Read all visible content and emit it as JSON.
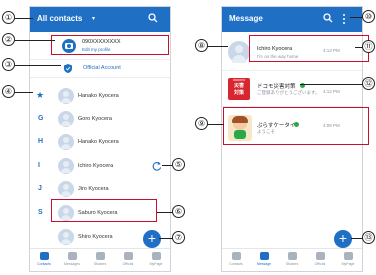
{
  "callouts": [
    "①",
    "②",
    "③",
    "④",
    "⑤",
    "⑥",
    "⑦",
    "⑧",
    "⑨",
    "⑩",
    "⑪",
    "⑫",
    "⑬"
  ],
  "contacts_screen": {
    "title": "All contacts",
    "caret": "▾",
    "profile": {
      "number": "090XXXXXXXX",
      "subtitle": "Edit my profile"
    },
    "official_account": "Official Account",
    "favorite_star": "★",
    "rows": [
      {
        "letter": "",
        "name": "Hanako Kyocera"
      },
      {
        "letter": "G",
        "name": "Goro Kyocera"
      },
      {
        "letter": "H",
        "name": "Hanako Kyocera"
      },
      {
        "letter": "I",
        "name": "Ichiro Kyocera"
      },
      {
        "letter": "J",
        "name": "Jiro Kyocera"
      },
      {
        "letter": "S",
        "name": "Saburo Kyocera"
      },
      {
        "letter": "",
        "name": "Shiro Kyocera"
      }
    ],
    "fab": "+",
    "nav": [
      "Contacts",
      "Messages",
      "Stickers",
      "Official",
      "MyPage"
    ]
  },
  "message_screen": {
    "title": "Message",
    "threads": [
      {
        "name": "Ichiro Kyocera",
        "preview": "I'm on the way home",
        "time": "4:13 PM"
      },
      {
        "badge": [
          "docomo",
          "災害",
          "対策"
        ],
        "name": "ドコモ災害対策",
        "preview": "ご登録ありがとうございます。",
        "time": "4:12 PM"
      },
      {
        "name": "ぷらすケータイ",
        "preview": "ようこそ",
        "time": "4:09 PM"
      }
    ],
    "fab": "+",
    "nav": [
      "Contacts",
      "Message",
      "Stickers",
      "Official",
      "MyPage"
    ]
  },
  "colors": {
    "brand_blue": "#1f6fc4",
    "highlight_red": "#c8102e",
    "verified_green": "#2ba84a",
    "docomo_red": "#d8262f"
  }
}
